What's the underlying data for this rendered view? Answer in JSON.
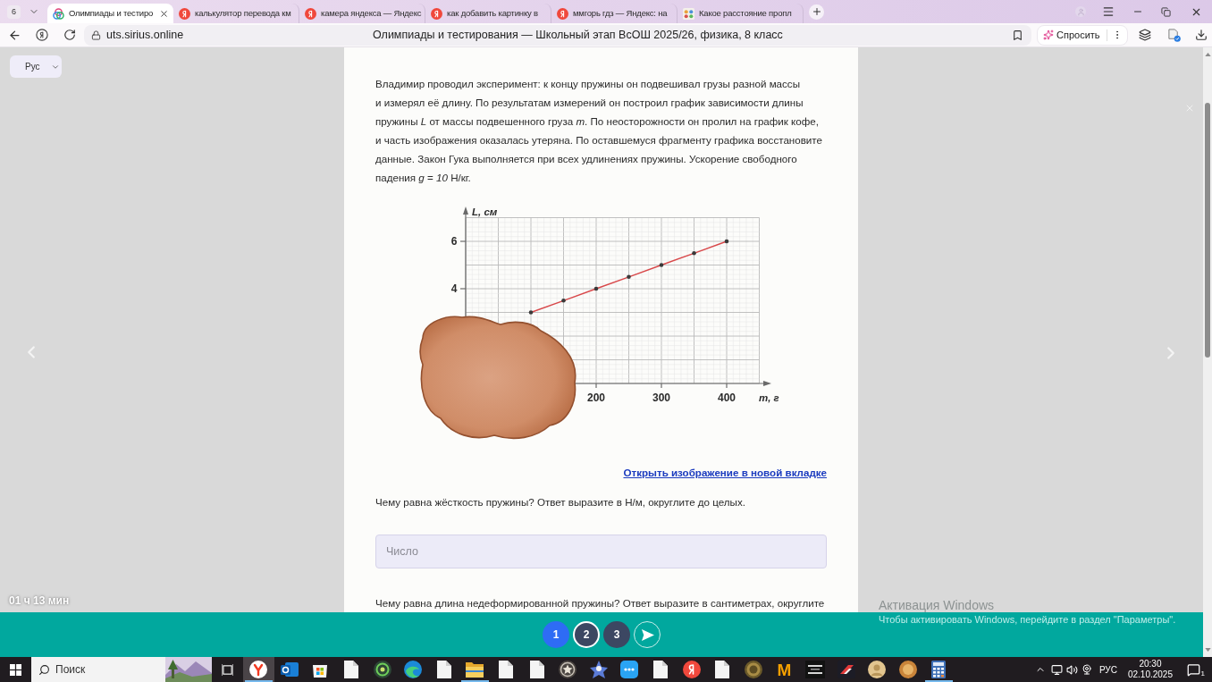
{
  "browser": {
    "tab_count": "6",
    "tabs": [
      {
        "title": "Олимпиады и тестиро",
        "kind": "sirius",
        "selected": true
      },
      {
        "title": "калькулятор перевода км",
        "kind": "yandex",
        "selected": false
      },
      {
        "title": "камера яндекса — Яндекс",
        "kind": "yandex",
        "selected": false
      },
      {
        "title": "как добавить картинку в",
        "kind": "yandex",
        "selected": false
      },
      {
        "title": "ммгорь гдз — Яндекс: на",
        "kind": "yandex",
        "selected": false
      },
      {
        "title": "Какое расстояние пропл",
        "kind": "gdz",
        "selected": false
      }
    ],
    "url": "uts.sirius.online",
    "page_title": "Олимпиады и тестирования — Школьный этап ВсОШ 2025/26, физика, 8 класс",
    "ask_label": "Спросить"
  },
  "page": {
    "language": "Рус",
    "timer": "01 ч 13 мин",
    "task": {
      "text": "Владимир проводил эксперимент: к концу пружины он подвешивал грузы разной массы\nи измерял её длину. По результатам измерений он построил график зависимости длины\nпружины *L* от массы подвешенного груза *m*. По неосторожности он пролил на график кофе,\nи часть изображения оказалась утеряна. По оставшемуся фрагменту графика восстановите\nданные. Закон Гука выполняется при всех удлинениях пружины. Ускорение свободного\nпадения *g* = *10* Н/кг.",
      "chart_data": {
        "type": "line",
        "xlabel": "m, г",
        "ylabel": "L, см",
        "x": [
          100,
          150,
          200,
          250,
          300,
          350,
          400
        ],
        "series": [
          {
            "color": "#d8484a",
            "values": [
              3,
              3.5,
              4,
              4.5,
              5,
              5.5,
              6
            ]
          }
        ],
        "xlim": [
          0,
          450
        ],
        "ylim": [
          0,
          7
        ],
        "xticks": [
          200,
          300,
          400
        ],
        "yticks": [
          4,
          6
        ],
        "grid": true
      },
      "image_link": "Открыть изображение в новой вкладке",
      "questions": [
        {
          "text": "Чему равна жёсткость пружины? Ответ выразите в Н/м, округлите до целых.",
          "placeholder": "Число"
        },
        {
          "text": "Чему равна длина недеформированной пружины? Ответ выразите в сантиметрах, округлите"
        }
      ]
    }
  },
  "question_nav": [
    {
      "label": "1",
      "selected": true,
      "outlined": false
    },
    {
      "label": "2",
      "selected": false,
      "outlined": true
    },
    {
      "label": "3",
      "selected": false,
      "outlined": false
    }
  ],
  "windows_activation": {
    "title": "Активация Windows",
    "text": "Чтобы активировать Windows, перейдите в раздел \"Параметры\"."
  },
  "taskbar": {
    "search_placeholder": "Поиск",
    "apps": [
      {
        "kind": "browser",
        "running": true,
        "focused": true
      },
      {
        "kind": "mail",
        "running": false,
        "focused": false
      },
      {
        "kind": "store",
        "running": false,
        "focused": false
      },
      {
        "kind": "document",
        "running": false,
        "focused": false
      },
      {
        "kind": "disc",
        "running": false,
        "focused": false
      },
      {
        "kind": "wave",
        "running": false,
        "focused": false
      },
      {
        "kind": "document",
        "running": false,
        "focused": false
      },
      {
        "kind": "folder",
        "running": true,
        "focused": false
      },
      {
        "kind": "document",
        "running": false,
        "focused": false
      },
      {
        "kind": "document",
        "running": false,
        "focused": false
      },
      {
        "kind": "emblem",
        "running": false,
        "focused": false
      },
      {
        "kind": "figure",
        "running": false,
        "focused": false
      },
      {
        "kind": "chat",
        "running": false,
        "focused": false
      },
      {
        "kind": "document",
        "running": false,
        "focused": false
      },
      {
        "kind": "circle_logo",
        "running": false,
        "focused": false
      },
      {
        "kind": "document",
        "running": false,
        "focused": false
      },
      {
        "kind": "coin",
        "running": false,
        "focused": false
      },
      {
        "kind": "letter",
        "label": "M",
        "running": false,
        "focused": false
      },
      {
        "kind": "poster",
        "running": false,
        "focused": false
      },
      {
        "kind": "racing",
        "running": false,
        "focused": false
      },
      {
        "kind": "avatar",
        "running": false,
        "focused": false
      },
      {
        "kind": "badge",
        "running": false,
        "focused": false
      },
      {
        "kind": "calculator",
        "running": true,
        "focused": false
      }
    ],
    "language": "РУС",
    "time": "20:30",
    "date": "02.10.2025",
    "notification_count": "1"
  }
}
